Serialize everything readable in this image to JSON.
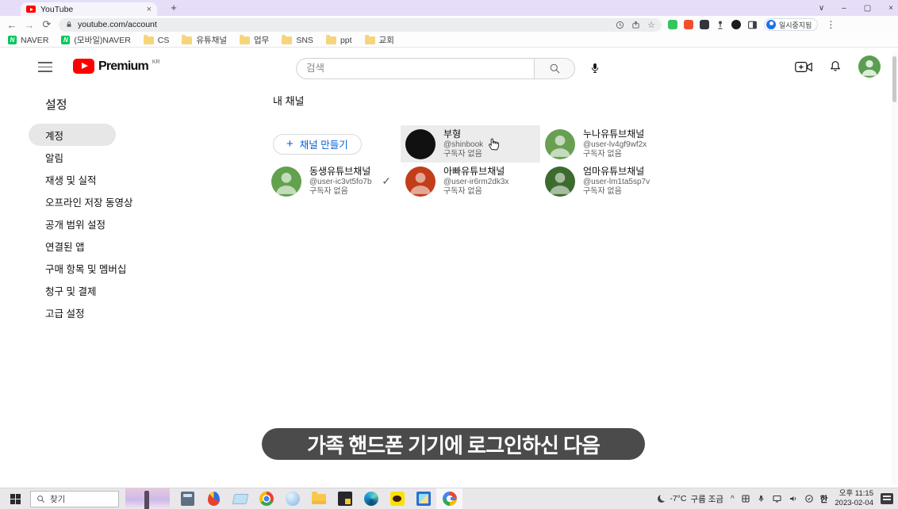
{
  "icons": {
    "plus": "+",
    "close": "×",
    "kebab": "⋮",
    "minimize": "–",
    "restore": "▢",
    "chevron_down": "∨",
    "back": "←",
    "forward": "→",
    "reload": "⟳",
    "star": "☆",
    "check": "✓",
    "caret_up": "^"
  },
  "browser": {
    "tab_title": "YouTube",
    "url": "youtube.com/account",
    "profile_label": "일시중지됨",
    "bookmarks": [
      {
        "label": "NAVER",
        "icon": "naver"
      },
      {
        "label": "(모바일)NAVER",
        "icon": "naver"
      },
      {
        "label": "CS",
        "icon": "folder"
      },
      {
        "label": "유튜채널",
        "icon": "folder"
      },
      {
        "label": "업무",
        "icon": "folder"
      },
      {
        "label": "SNS",
        "icon": "folder"
      },
      {
        "label": "ppt",
        "icon": "folder"
      },
      {
        "label": "교회",
        "icon": "folder"
      }
    ]
  },
  "youtube": {
    "brand": "Premium",
    "brand_region": "KR",
    "search_placeholder": "검색",
    "sidebar": {
      "title": "설정",
      "items": [
        {
          "label": "계정",
          "active": true
        },
        {
          "label": "알림"
        },
        {
          "label": "재생 및 실적"
        },
        {
          "label": "오프라인 저장 동영상"
        },
        {
          "label": "공개 범위 설정"
        },
        {
          "label": "연결된 앱"
        },
        {
          "label": "구매 항목 및 멤버십"
        },
        {
          "label": "청구 및 결제"
        },
        {
          "label": "고급 설정"
        }
      ]
    },
    "main": {
      "title": "내 채널",
      "create_channel_label": "채널 만들기",
      "channels": [
        {
          "name": "부형",
          "handle": "@shinbook",
          "subscribers": "구독자 없음",
          "color": "#111111",
          "hovered": true
        },
        {
          "name": "누나유튜브채널",
          "handle": "@user-lv4gf9wf2x",
          "subscribers": "구독자 없음",
          "color": "#6a9f52"
        },
        {
          "name": "동생유튜브채널",
          "handle": "@user-ic3vt5fo7b",
          "subscribers": "구독자 없음",
          "color": "#63a14e",
          "selected": true
        },
        {
          "name": "아빠유튜브채널",
          "handle": "@user-ir6rm2dk3x",
          "subscribers": "구독자 없음",
          "color": "#c23d18"
        },
        {
          "name": "엄마유튜브채널",
          "handle": "@user-lm1ta5sp7v",
          "subscribers": "구독자 없음",
          "color": "#3c6b2f"
        }
      ]
    },
    "avatar_color": "#5b9e51"
  },
  "caption": {
    "text": "가족 핸드폰 기기에 로그인하신 다음"
  },
  "taskbar": {
    "search_placeholder": "찾기",
    "app_icons": [
      "calculator",
      "alyac-antivirus",
      "notebook",
      "chrome",
      "nateon",
      "file-explorer",
      "premiere",
      "edge",
      "kakaotalk",
      "photos",
      "google"
    ],
    "weather_temp": "-7°C",
    "weather_desc": "구름 조금",
    "ime": "한",
    "time": "오후 11:15",
    "date": "2023-02-04"
  }
}
